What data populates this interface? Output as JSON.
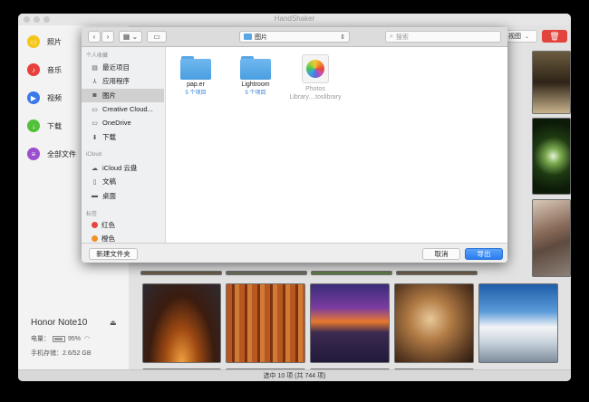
{
  "window": {
    "title": "HandShaker"
  },
  "sidebar": {
    "items": [
      {
        "label": "照片",
        "icon": "photos-icon",
        "color": "#f5c518"
      },
      {
        "label": "音乐",
        "icon": "music-icon",
        "color": "#e8403a"
      },
      {
        "label": "视频",
        "icon": "video-icon",
        "color": "#3a79e8"
      },
      {
        "label": "下载",
        "icon": "download-icon",
        "color": "#53c03a"
      },
      {
        "label": "全部文件",
        "icon": "files-icon",
        "color": "#9b4fd0"
      }
    ]
  },
  "device": {
    "name": "Honor Note10",
    "battery_label": "电量：",
    "battery_value": "95%",
    "storage": "手机存储：2.6/52 GB"
  },
  "toolbar": {
    "view_label": "视图"
  },
  "status": {
    "text": "选中 10 项 (共 744 项)"
  },
  "dialog": {
    "path": "图片",
    "search_placeholder": "搜索",
    "sections": {
      "favorites": "个人收藏",
      "icloud": "iCloud",
      "tags": "标签"
    },
    "favorites": [
      {
        "label": "最近项目",
        "icon": "recent-icon"
      },
      {
        "label": "应用程序",
        "icon": "applications-icon"
      },
      {
        "label": "图片",
        "icon": "camera-icon",
        "selected": true
      },
      {
        "label": "Creative Cloud...",
        "icon": "folder-icon"
      },
      {
        "label": "OneDrive",
        "icon": "folder-icon"
      },
      {
        "label": "下载",
        "icon": "downloads-icon"
      }
    ],
    "icloud": [
      {
        "label": "iCloud 云盘",
        "icon": "cloud-icon"
      },
      {
        "label": "文稿",
        "icon": "document-icon"
      },
      {
        "label": "桌面",
        "icon": "desktop-icon"
      }
    ],
    "tags": [
      {
        "label": "红色",
        "color": "#e5463d"
      },
      {
        "label": "橙色",
        "color": "#f0912c"
      }
    ],
    "files": [
      {
        "name": "pap.er",
        "count": "5 个项目"
      },
      {
        "name": "Lightroom",
        "count": "5 个项目"
      },
      {
        "name": "Photos Library....toslibrary",
        "count": ""
      }
    ],
    "new_folder": "新建文件夹",
    "cancel": "取消",
    "export": "导出"
  }
}
